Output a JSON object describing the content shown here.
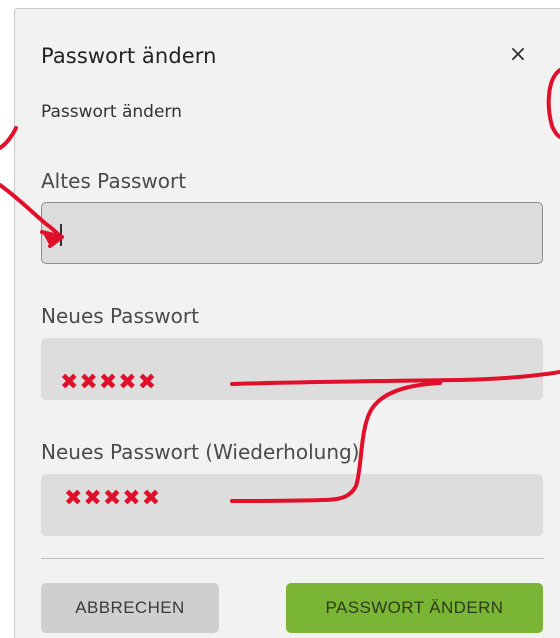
{
  "dialog": {
    "title": "Passwort ändern",
    "close_icon": "×",
    "subtitle": "Passwort ändern"
  },
  "fields": [
    {
      "label": "Altes Passwort",
      "value": "",
      "focused": true
    },
    {
      "label": "Neues Passwort",
      "value": ""
    },
    {
      "label": "Neues Passwort (Wiederholung)",
      "value": ""
    }
  ],
  "annotations": {
    "new_password_marks": "✖✖✖✖✖",
    "repeat_password_marks": "✖✖✖✖✖",
    "color": "#e0102a"
  },
  "buttons": {
    "cancel_label": "ABBRECHEN",
    "submit_label": "PASSWORT ÄNDERN"
  },
  "colors": {
    "accent": "#7bb536",
    "dialog_bg": "#f2f2f2",
    "field_bg": "#dddddd"
  }
}
